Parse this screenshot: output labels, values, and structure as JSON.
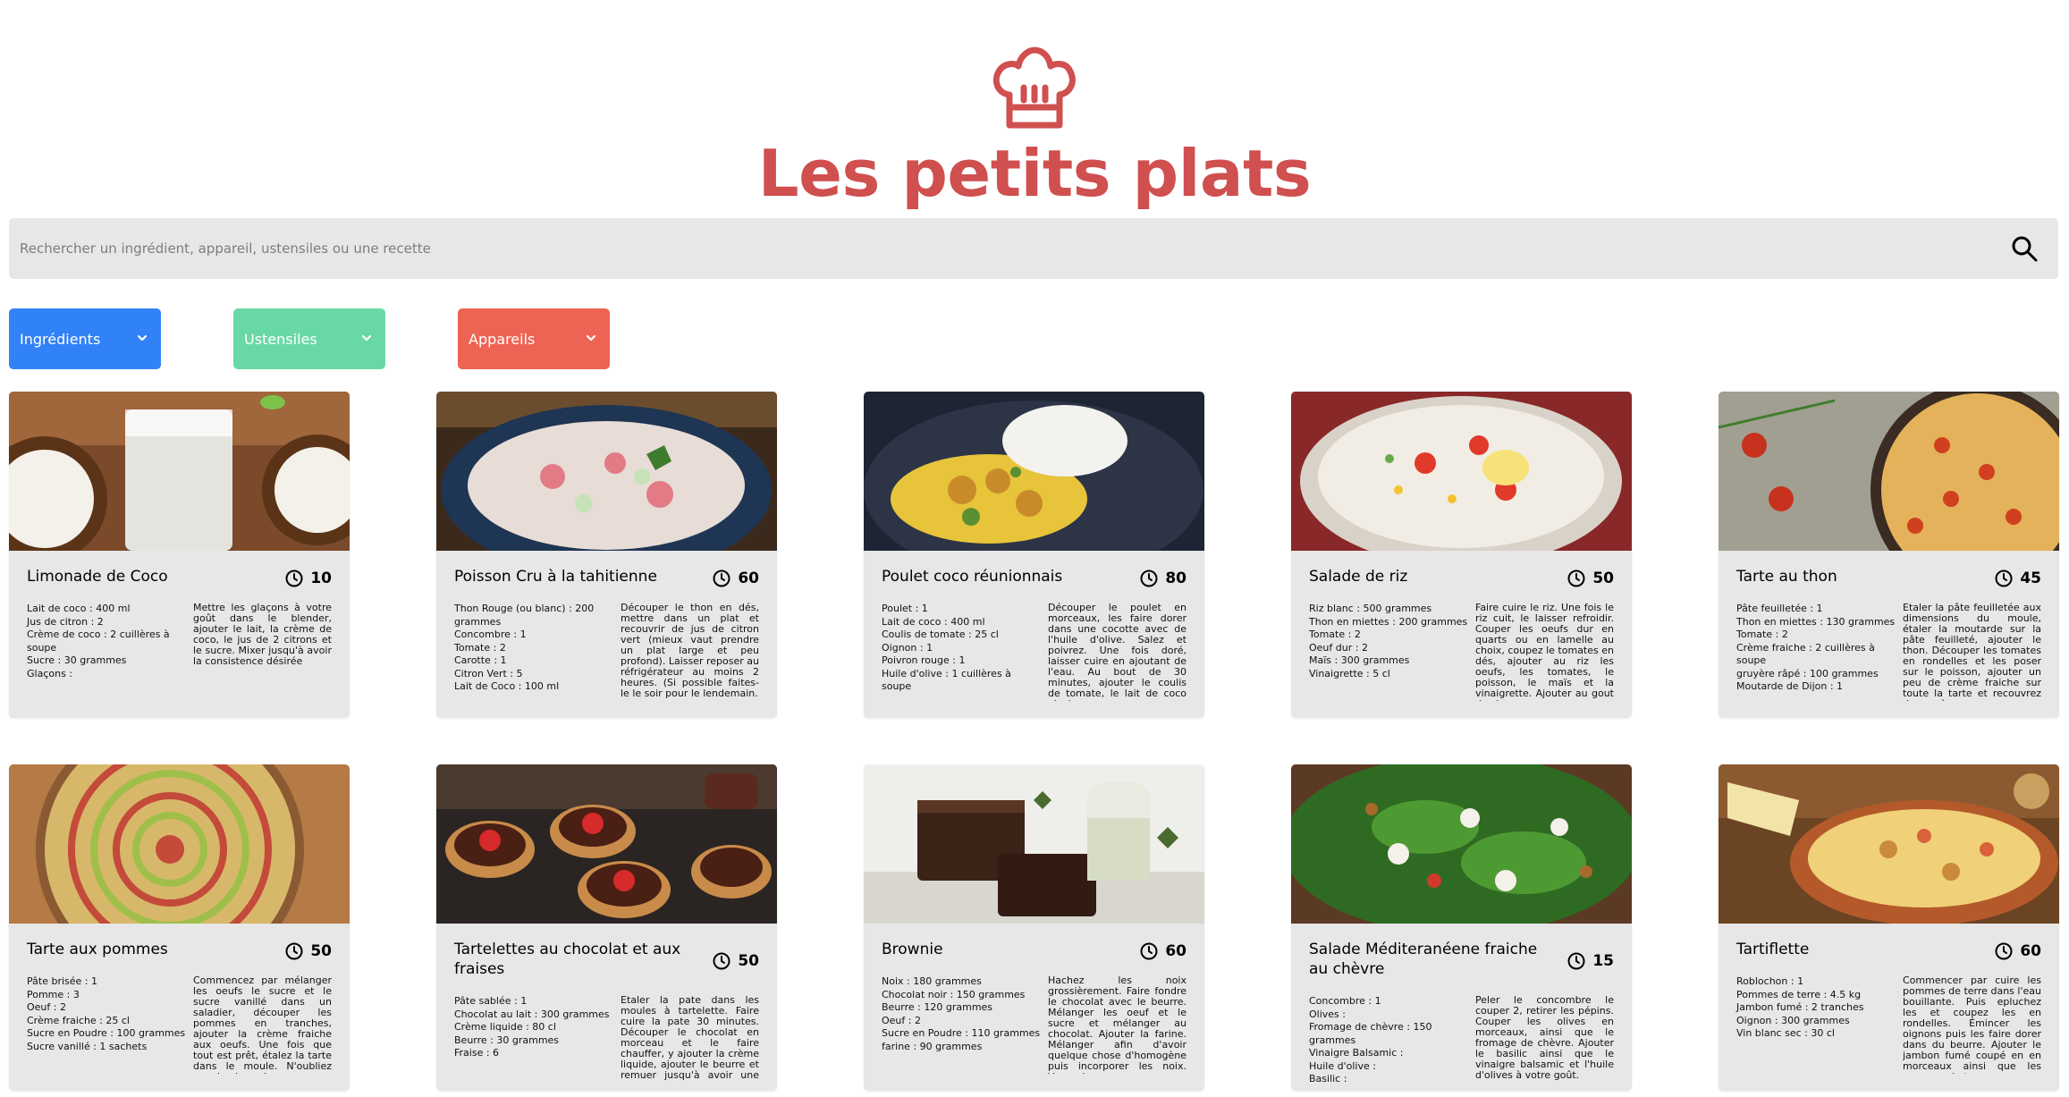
{
  "header": {
    "title": "Les petits plats",
    "logo_icon": "chef-hat-icon"
  },
  "search": {
    "placeholder": "Rechercher un ingrédient, appareil, ustensiles ou une recette",
    "icon": "search-icon"
  },
  "filters": [
    {
      "label": "Ingrédients",
      "color": "#3282F7"
    },
    {
      "label": "Ustensiles",
      "color": "#68D9A4"
    },
    {
      "label": "Appareils",
      "color": "#ED6454"
    }
  ],
  "recipes": [
    {
      "title": "Limonade de Coco",
      "time": "10",
      "ingredients": [
        "Lait de coco : 400 ml",
        "Jus de citron : 2",
        "Crème de coco : 2 cuillères à soupe",
        "Sucre : 30 grammes",
        "Glaçons :"
      ],
      "description": "Mettre les glaçons à votre goût dans le blender, ajouter le lait, la crème de coco, le jus de 2 citrons et le sucre. Mixer jusqu'à avoir la consistence désirée"
    },
    {
      "title": "Poisson Cru à la tahitienne",
      "time": "60",
      "ingredients": [
        "Thon Rouge (ou blanc) : 200 grammes",
        "Concombre : 1",
        "Tomate : 2",
        "Carotte : 1",
        "Citron Vert : 5",
        "Lait de Coco : 100 ml"
      ],
      "description": "Découper le thon en dés, mettre dans un plat et recouvrir de jus de citron vert (mieux vaut prendre un plat large et peu profond). Laisser reposer au réfrigérateur au moins 2 heures. (Si possible faites-le le soir pour le lendemain."
    },
    {
      "title": "Poulet coco réunionnais",
      "time": "80",
      "ingredients": [
        "Poulet : 1",
        "Lait de coco : 400 ml",
        "Coulis de tomate : 25 cl",
        "Oignon : 1",
        "Poivron rouge : 1",
        "Huile d'olive : 1 cuillères à soupe"
      ],
      "description": "Découper le poulet en morceaux, les faire dorer dans une cocotte avec de l'huile d'olive. Salez et poivrez. Une fois doré, laisser cuire en ajoutant de l'eau. Au bout de 30 minutes, ajouter le coulis de tomate, le lait de coco ainsi"
    },
    {
      "title": "Salade de riz",
      "time": "50",
      "ingredients": [
        "Riz blanc : 500 grammes",
        "Thon en miettes : 200 grammes",
        "Tomate : 2",
        "Oeuf dur : 2",
        "Maïs : 300 grammes",
        "Vinaigrette : 5 cl"
      ],
      "description": "Faire cuire le riz. Une fois le riz cuit, le laisser refroidir. Couper les oeufs dur en quarts ou en lamelle au choix, coupez le tomates en dés, ajouter au riz les oeufs, les tomates, le poisson, le maïs et la vinaigrette. Ajouter au gout de chacun"
    },
    {
      "title": "Tarte au thon",
      "time": "45",
      "ingredients": [
        "Pâte feuilletée : 1",
        "Thon en miettes : 130 grammes",
        "Tomate : 2",
        "Crème fraiche : 2 cuillères à soupe",
        "gruyère râpé : 100 grammes",
        "Moutarde de Dijon : 1"
      ],
      "description": "Etaler la pâte feuilletée aux dimensions du moule, étaler la moutarde sur la pâte feuilleté, ajouter le thon. Découper les tomates en rondelles et les poser sur le poisson, ajouter un peu de crème fraiche sur toute la tarte et recouvrez de gruyère"
    },
    {
      "title": "Tarte aux pommes",
      "time": "50",
      "ingredients": [
        "Pâte brisée : 1",
        "Pomme : 3",
        "Oeuf : 2",
        "Crème fraiche : 25 cl",
        "Sucre en Poudre : 100 grammes",
        "Sucre vanillé : 1 sachets"
      ],
      "description": "Commencez par mélanger les oeufs le sucre et le sucre vanillé dans un saladier, découper les pommes en tranches, ajouter la crème fraiche aux oeufs. Une fois que tout est prêt, étalez la tarte dans le moule. N'oubliez pas de piquer le"
    },
    {
      "title": "Tartelettes au chocolat et aux fraises",
      "time": "50",
      "ingredients": [
        "Pâte sablée : 1",
        "Chocolat au lait : 300 grammes",
        "Crème liquide : 80 cl",
        "Beurre : 30 grammes",
        "Fraise : 6"
      ],
      "description": "Etaler la pate dans les moules à tartelette. Faire cuire la pate 30 minutes. Découper le chocolat en morceau et le faire chauffer, y ajouter la crème liquide, ajouter le beurre et remuer jusqu'à avoir une pâte homogène. Verser la pate"
    },
    {
      "title": "Brownie",
      "time": "60",
      "ingredients": [
        "Noix : 180 grammes",
        "Chocolat noir : 150 grammes",
        "Beurre : 120 grammes",
        "Oeuf : 2",
        "Sucre en Poudre : 110 grammes",
        "farine : 90 grammes"
      ],
      "description": "Hachez les noix grossièrement. Faire fondre le chocolat avec le beurre. Mélanger les oeuf et le sucre et mélanger au chocolat. Ajouter la farine. Mélanger afin d'avoir quelque chose d'homogène puis incorporer les noix. Verser la"
    },
    {
      "title": "Salade Méditeranéene fraiche au chèvre",
      "time": "15",
      "ingredients": [
        "Concombre : 1",
        "Olives :",
        "Fromage de chèvre : 150 grammes",
        "Vinaigre Balsamic :",
        "Huile d'olive :",
        "Basilic :"
      ],
      "description": "Peler le concombre le couper 2, retirer les pépins. Couper les olives en morceaux, ainsi que le fromage de chèvre. Ajouter le basilic ainsi que le vinaigre balsamic et l'huile d'olives à votre goût."
    },
    {
      "title": "Tartiflette",
      "time": "60",
      "ingredients": [
        "Roblochon : 1",
        "Pommes de terre : 4.5 kg",
        "Jambon fumé : 2 tranches",
        "Oignon : 300 grammes",
        "Vin blanc sec : 30 cl"
      ],
      "description": "Commencer par cuire les pommes de terre dans l'eau bouillante. Puis epluchez les et coupez les en rondelles. Émincer les oignons puis les faire dorer dans du beurre. Ajouter le jambon fumé coupé en en morceaux ainsi que les pommes de terres."
    }
  ]
}
